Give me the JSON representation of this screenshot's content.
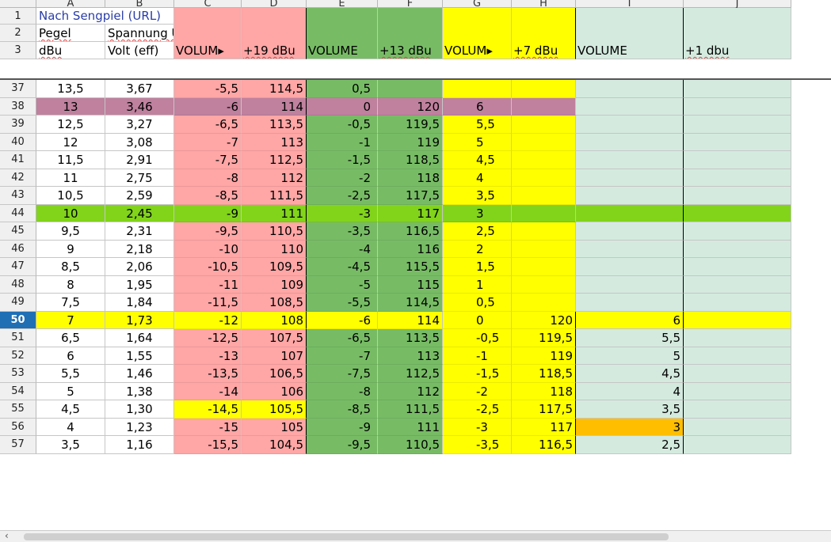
{
  "columns": [
    "A",
    "B",
    "C",
    "D",
    "E",
    "F",
    "G",
    "H",
    "I",
    "J"
  ],
  "active_row": "50",
  "colors": {
    "red": "#ffa6a6",
    "green": "#77bc65",
    "yellow": "#ffff00",
    "teal": "#d4eadf",
    "purple": "#bf819e",
    "lime": "#81d41a",
    "orange": "#ffbf00",
    "link": "#2a3da8"
  },
  "header_rows": [
    {
      "row": "1",
      "cells": [
        "Nach Sengpiel (URL)",
        "",
        "",
        "",
        "",
        "",
        "",
        "",
        "",
        ""
      ]
    },
    {
      "row": "2",
      "cells": [
        "Pegel",
        "Spannung U",
        "",
        "",
        "",
        "",
        "",
        "",
        "",
        ""
      ]
    },
    {
      "row": "3",
      "cells": [
        "dBu",
        "Volt (eff)",
        "VOLUM▸",
        "+19 dBu",
        "VOLUME",
        "+13 dBu",
        "VOLUM▸",
        "+7 dBu",
        "VOLUME",
        "+1 dbu"
      ]
    }
  ],
  "rows": [
    {
      "row": "37",
      "cells": [
        "13,5",
        "3,67",
        "-5,5",
        "114,5",
        "0,5",
        "",
        "",
        "",
        "",
        ""
      ]
    },
    {
      "row": "38",
      "cells": [
        "13",
        "3,46",
        "-6",
        "114",
        "0",
        "120",
        "6",
        "",
        "",
        ""
      ]
    },
    {
      "row": "39",
      "cells": [
        "12,5",
        "3,27",
        "-6,5",
        "113,5",
        "-0,5",
        "119,5",
        "5,5",
        "",
        "",
        ""
      ]
    },
    {
      "row": "40",
      "cells": [
        "12",
        "3,08",
        "-7",
        "113",
        "-1",
        "119",
        "5",
        "",
        "",
        ""
      ]
    },
    {
      "row": "41",
      "cells": [
        "11,5",
        "2,91",
        "-7,5",
        "112,5",
        "-1,5",
        "118,5",
        "4,5",
        "",
        "",
        ""
      ]
    },
    {
      "row": "42",
      "cells": [
        "11",
        "2,75",
        "-8",
        "112",
        "-2",
        "118",
        "4",
        "",
        "",
        ""
      ]
    },
    {
      "row": "43",
      "cells": [
        "10,5",
        "2,59",
        "-8,5",
        "111,5",
        "-2,5",
        "117,5",
        "3,5",
        "",
        "",
        ""
      ]
    },
    {
      "row": "44",
      "cells": [
        "10",
        "2,45",
        "-9",
        "111",
        "-3",
        "117",
        "3",
        "",
        "",
        ""
      ]
    },
    {
      "row": "45",
      "cells": [
        "9,5",
        "2,31",
        "-9,5",
        "110,5",
        "-3,5",
        "116,5",
        "2,5",
        "",
        "",
        ""
      ]
    },
    {
      "row": "46",
      "cells": [
        "9",
        "2,18",
        "-10",
        "110",
        "-4",
        "116",
        "2",
        "",
        "",
        ""
      ]
    },
    {
      "row": "47",
      "cells": [
        "8,5",
        "2,06",
        "-10,5",
        "109,5",
        "-4,5",
        "115,5",
        "1,5",
        "",
        "",
        ""
      ]
    },
    {
      "row": "48",
      "cells": [
        "8",
        "1,95",
        "-11",
        "109",
        "-5",
        "115",
        "1",
        "",
        "",
        ""
      ]
    },
    {
      "row": "49",
      "cells": [
        "7,5",
        "1,84",
        "-11,5",
        "108,5",
        "-5,5",
        "114,5",
        "0,5",
        "",
        "",
        ""
      ]
    },
    {
      "row": "50",
      "cells": [
        "7",
        "1,73",
        "-12",
        "108",
        "-6",
        "114",
        "0",
        "120",
        "6",
        ""
      ]
    },
    {
      "row": "51",
      "cells": [
        "6,5",
        "1,64",
        "-12,5",
        "107,5",
        "-6,5",
        "113,5",
        "-0,5",
        "119,5",
        "5,5",
        ""
      ]
    },
    {
      "row": "52",
      "cells": [
        "6",
        "1,55",
        "-13",
        "107",
        "-7",
        "113",
        "-1",
        "119",
        "5",
        ""
      ]
    },
    {
      "row": "53",
      "cells": [
        "5,5",
        "1,46",
        "-13,5",
        "106,5",
        "-7,5",
        "112,5",
        "-1,5",
        "118,5",
        "4,5",
        ""
      ]
    },
    {
      "row": "54",
      "cells": [
        "5",
        "1,38",
        "-14",
        "106",
        "-8",
        "112",
        "-2",
        "118",
        "4",
        ""
      ]
    },
    {
      "row": "55",
      "cells": [
        "4,5",
        "1,30",
        "-14,5",
        "105,5",
        "-8,5",
        "111,5",
        "-2,5",
        "117,5",
        "3,5",
        ""
      ]
    },
    {
      "row": "56",
      "cells": [
        "4",
        "1,23",
        "-15",
        "105",
        "-9",
        "111",
        "-3",
        "117",
        "3",
        ""
      ]
    },
    {
      "row": "57",
      "cells": [
        "3,5",
        "1,16",
        "-15,5",
        "104,5",
        "-9,5",
        "110,5",
        "-3,5",
        "116,5",
        "2,5",
        ""
      ]
    }
  ],
  "scrollbar": {
    "left_arrow": "‹"
  }
}
